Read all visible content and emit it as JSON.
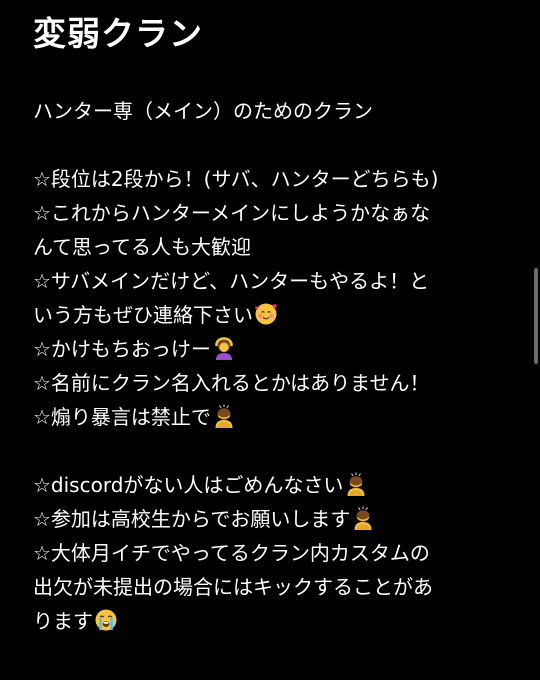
{
  "post": {
    "title": "変弱クラン",
    "lines": [
      "ハンター専（メイン）のためのクラン",
      "",
      "☆段位は2段から！(サバ、ハンターどちらも)",
      "☆これからハンターメインにしようかなぁな",
      "んて思ってる人も大歓迎",
      "☆サバメインだけど、ハンターもやるよ！と",
      "いう方もぜひ連絡下さい",
      "☆かけもちおっけー",
      "☆名前にクラン名入れるとかはありません！",
      "☆煽り暴言は禁止で",
      "",
      "☆discordがない人はごめんなさい",
      "☆参加は高校生からでお願いします",
      "☆大体月イチでやってるクラン内カスタムの",
      "出欠が未提出の場合にはキックすることがあ",
      "ります"
    ]
  },
  "icons": {
    "smiling-face-with-hearts": "smiling-face-with-hearts-icon",
    "person-ok-gesture": "person-gesturing-ok-icon",
    "person-bowing": "person-bowing-icon",
    "crying-face": "loudly-crying-face-icon"
  },
  "colors": {
    "background": "#000000",
    "text": "#ffffff",
    "emoji_skin": "#F5C542",
    "heart": "#E83E5C"
  }
}
